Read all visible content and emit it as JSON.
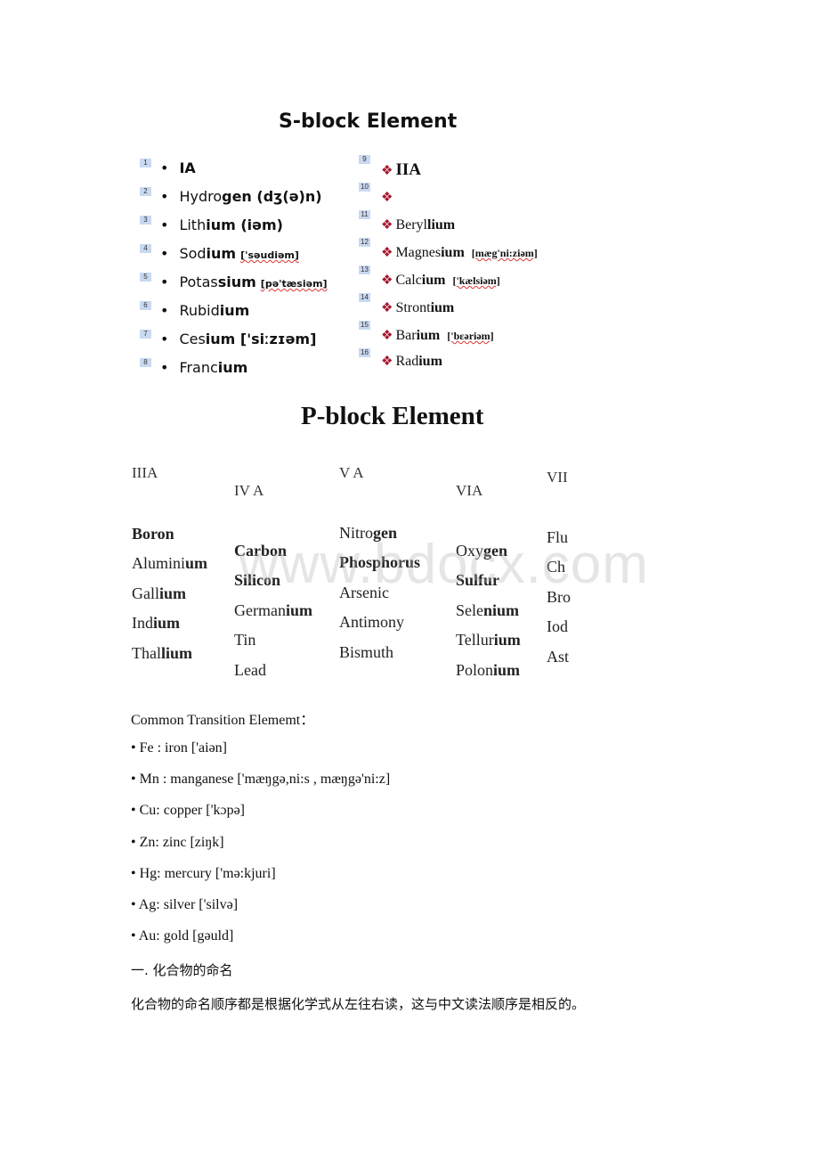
{
  "s_block": {
    "title": "S-block Element",
    "left": [
      {
        "n": "1",
        "plain": "",
        "bold": "IA",
        "pron": ""
      },
      {
        "n": "2",
        "plain": "Hydro",
        "bold": "gen (dʒ(ə)n)",
        "pron": ""
      },
      {
        "n": "3",
        "plain": "Lith",
        "bold": "ium (iəm)",
        "pron": ""
      },
      {
        "n": "4",
        "plain": "Sod",
        "bold": "ium",
        "pron": "['səudiəm]"
      },
      {
        "n": "5",
        "plain": "Potas",
        "bold": "sium",
        "pron": "[pə'tæsiəm]"
      },
      {
        "n": "6",
        "plain": "Rubid",
        "bold": "ium",
        "pron": ""
      },
      {
        "n": "7",
        "plain": "Ces",
        "bold": "ium ['siːzɪəm]",
        "pron": ""
      },
      {
        "n": "8",
        "plain": "Franc",
        "bold": "ium",
        "pron": ""
      }
    ],
    "right": [
      {
        "n": "9",
        "plain": "",
        "bold": "IIA",
        "pron": ""
      },
      {
        "n": "10",
        "plain": "",
        "bold": "",
        "pron": ""
      },
      {
        "n": "11",
        "plain": "Beryl",
        "bold": "lium",
        "pron": ""
      },
      {
        "n": "12",
        "plain": "Magnes",
        "bold": "ium",
        "pron": "[mæg'ni:ziəm]"
      },
      {
        "n": "13",
        "plain": "Calc",
        "bold": "ium",
        "pron": "['kælsiəm]"
      },
      {
        "n": "14",
        "plain": "Stront",
        "bold": "ium",
        "pron": ""
      },
      {
        "n": "15",
        "plain": "Bar",
        "bold": "ium",
        "pron": "['bεəriəm]"
      },
      {
        "n": "16",
        "plain": "Rad",
        "bold": "ium",
        "pron": ""
      }
    ]
  },
  "p_block": {
    "title": "P-block Element",
    "columns": [
      {
        "header": "IIIA",
        "items": [
          [
            "",
            "Boron"
          ],
          [
            "Alumini",
            "um"
          ],
          [
            "Gall",
            "ium"
          ],
          [
            "Ind",
            "ium"
          ],
          [
            "Thal",
            "lium"
          ]
        ]
      },
      {
        "header": "IV A",
        "items": [
          [
            "",
            "Carbon"
          ],
          [
            "",
            "Silicon"
          ],
          [
            "German",
            "ium"
          ],
          [
            "Tin",
            ""
          ],
          [
            "Lead",
            ""
          ]
        ]
      },
      {
        "header": "V A",
        "items": [
          [
            "Nitro",
            "gen"
          ],
          [
            "",
            "Phosphorus"
          ],
          [
            "Arsenic",
            ""
          ],
          [
            "Antimony",
            ""
          ],
          [
            "Bismuth",
            ""
          ]
        ]
      },
      {
        "header": "VIA",
        "items": [
          [
            "Oxy",
            "gen"
          ],
          [
            "",
            "Sulfur"
          ],
          [
            "Sele",
            "nium"
          ],
          [
            "Tellur",
            "ium"
          ],
          [
            "Polon",
            "ium"
          ]
        ]
      },
      {
        "header": "VII",
        "items": [
          [
            "Flu",
            ""
          ],
          [
            "Ch",
            ""
          ],
          [
            "Bro",
            ""
          ],
          [
            "Iod",
            ""
          ],
          [
            "Ast",
            ""
          ]
        ]
      }
    ]
  },
  "watermark": "www.bdocx.com",
  "transition": {
    "heading": "Common Transition Elememt：",
    "items": [
      "• Fe : iron ['aiən]",
      "•  Mn : manganese ['mæŋgə,ni:s , mæŋgə'ni:z]",
      "•  Cu: copper ['kɔpə]",
      "•  Zn: zinc [ziŋk]",
      "•  Hg: mercury ['mə:kjuri]",
      "•  Ag: silver ['silvə]",
      "•  Au: gold [gəuld]"
    ]
  },
  "section": {
    "heading": "一. 化合物的命名",
    "body": "化合物的命名顺序都是根据化学式从左往右读，这与中文读法顺序是相反的。"
  },
  "colors": {
    "diamond": "#a3162c",
    "number_box": "#c9d9f1"
  }
}
